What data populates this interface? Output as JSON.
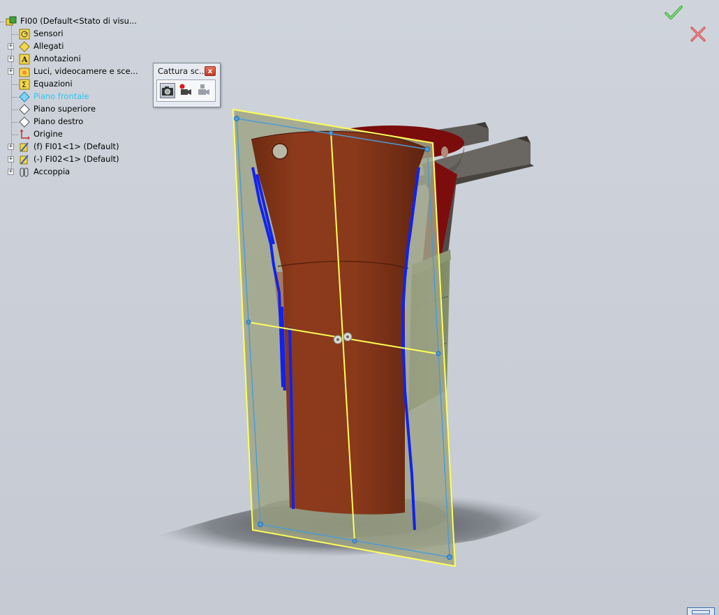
{
  "feature_tree": {
    "root": {
      "label": "FI00  (Default<Stato di visu...",
      "icon": "assembly-icon"
    },
    "items": [
      {
        "label": "Sensori",
        "icon": "sensor-icon",
        "expandable": false
      },
      {
        "label": "Allegati",
        "icon": "attachment-icon",
        "expandable": true
      },
      {
        "label": "Annotazioni",
        "icon": "annotation-icon",
        "expandable": true
      },
      {
        "label": "Luci, videocamere e sce...",
        "icon": "lights-folder-icon",
        "expandable": true
      },
      {
        "label": "Equazioni",
        "icon": "equation-icon",
        "expandable": false
      },
      {
        "label": "Piano frontale",
        "icon": "plane-icon",
        "expandable": false,
        "selected": true
      },
      {
        "label": "Piano superiore",
        "icon": "plane-icon",
        "expandable": false
      },
      {
        "label": "Piano destro",
        "icon": "plane-icon",
        "expandable": false
      },
      {
        "label": "Origine",
        "icon": "origin-icon",
        "expandable": false
      },
      {
        "label": "(f) FI01<1> (Default)",
        "icon": "part-icon",
        "expandable": true
      },
      {
        "label": "(-) FI02<1> (Default)",
        "icon": "part-icon",
        "expandable": true
      },
      {
        "label": "Accoppia",
        "icon": "mates-icon",
        "expandable": true
      }
    ]
  },
  "capture_toolbar": {
    "title": "Cattura sc...",
    "close_label": "x",
    "buttons": [
      {
        "name": "capture-image-button",
        "icon": "camera-icon",
        "active": true
      },
      {
        "name": "record-video-button",
        "icon": "record-icon",
        "active": false
      },
      {
        "name": "stop-record-button",
        "icon": "stop-record-icon",
        "active": false
      }
    ]
  },
  "confirm_corner": {
    "ok_icon": "checkmark-icon",
    "cancel_icon": "cancel-x-icon"
  },
  "colors": {
    "background": "#cbd0d8",
    "part_red": "#8a3a1c",
    "part_green": "#6f7a5a",
    "plane_yellow": "#ffff66",
    "plane_blue": "#4a9bd8",
    "edge_blue": "#1020e0",
    "tree_highlight": "#28c6f0"
  }
}
